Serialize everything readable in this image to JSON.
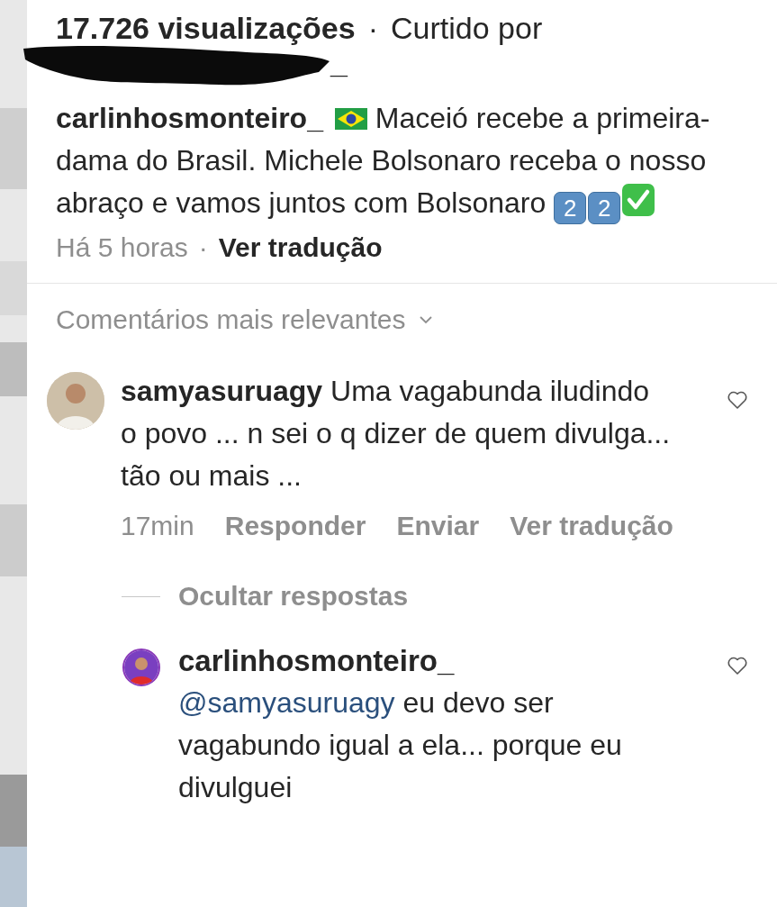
{
  "header": {
    "views": "17.726 visualizações",
    "separator": "·",
    "liked_by_label": "Curtido por",
    "liked_by_visible": "_",
    "redacted": true
  },
  "caption": {
    "username": "carlinhosmonteiro_",
    "parts": [
      {
        "kind": "flag"
      },
      {
        "kind": "text",
        "text": "Maceió recebe a primeira-dama do Brasil. Michele Bolsonaro receba o nosso abraço e vamos juntos com Bolsonaro"
      },
      {
        "kind": "keycap",
        "label": "2"
      },
      {
        "kind": "keycap",
        "label": "2"
      },
      {
        "kind": "check"
      }
    ],
    "time": "Há 5 horas",
    "separator": "·",
    "translate": "Ver tradução"
  },
  "sort": {
    "label": "Comentários mais relevantes",
    "expanded": false
  },
  "comments": [
    {
      "username": "samyasuruagy",
      "text": "Uma vagabunda iludindo o povo ... n sei o q dizer de quem divulga... tão ou mais ...",
      "liked": false,
      "actions": [
        "17min",
        "Responder",
        "Enviar",
        "Ver tradução"
      ],
      "replies_toggle": "Ocultar respostas",
      "replies": [
        {
          "username": "carlinhosmonteiro_",
          "mention": "@samyasuruagy",
          "text": "eu devo ser vagabundo igual a ela... porque eu divulguei",
          "liked": false
        }
      ]
    }
  ]
}
